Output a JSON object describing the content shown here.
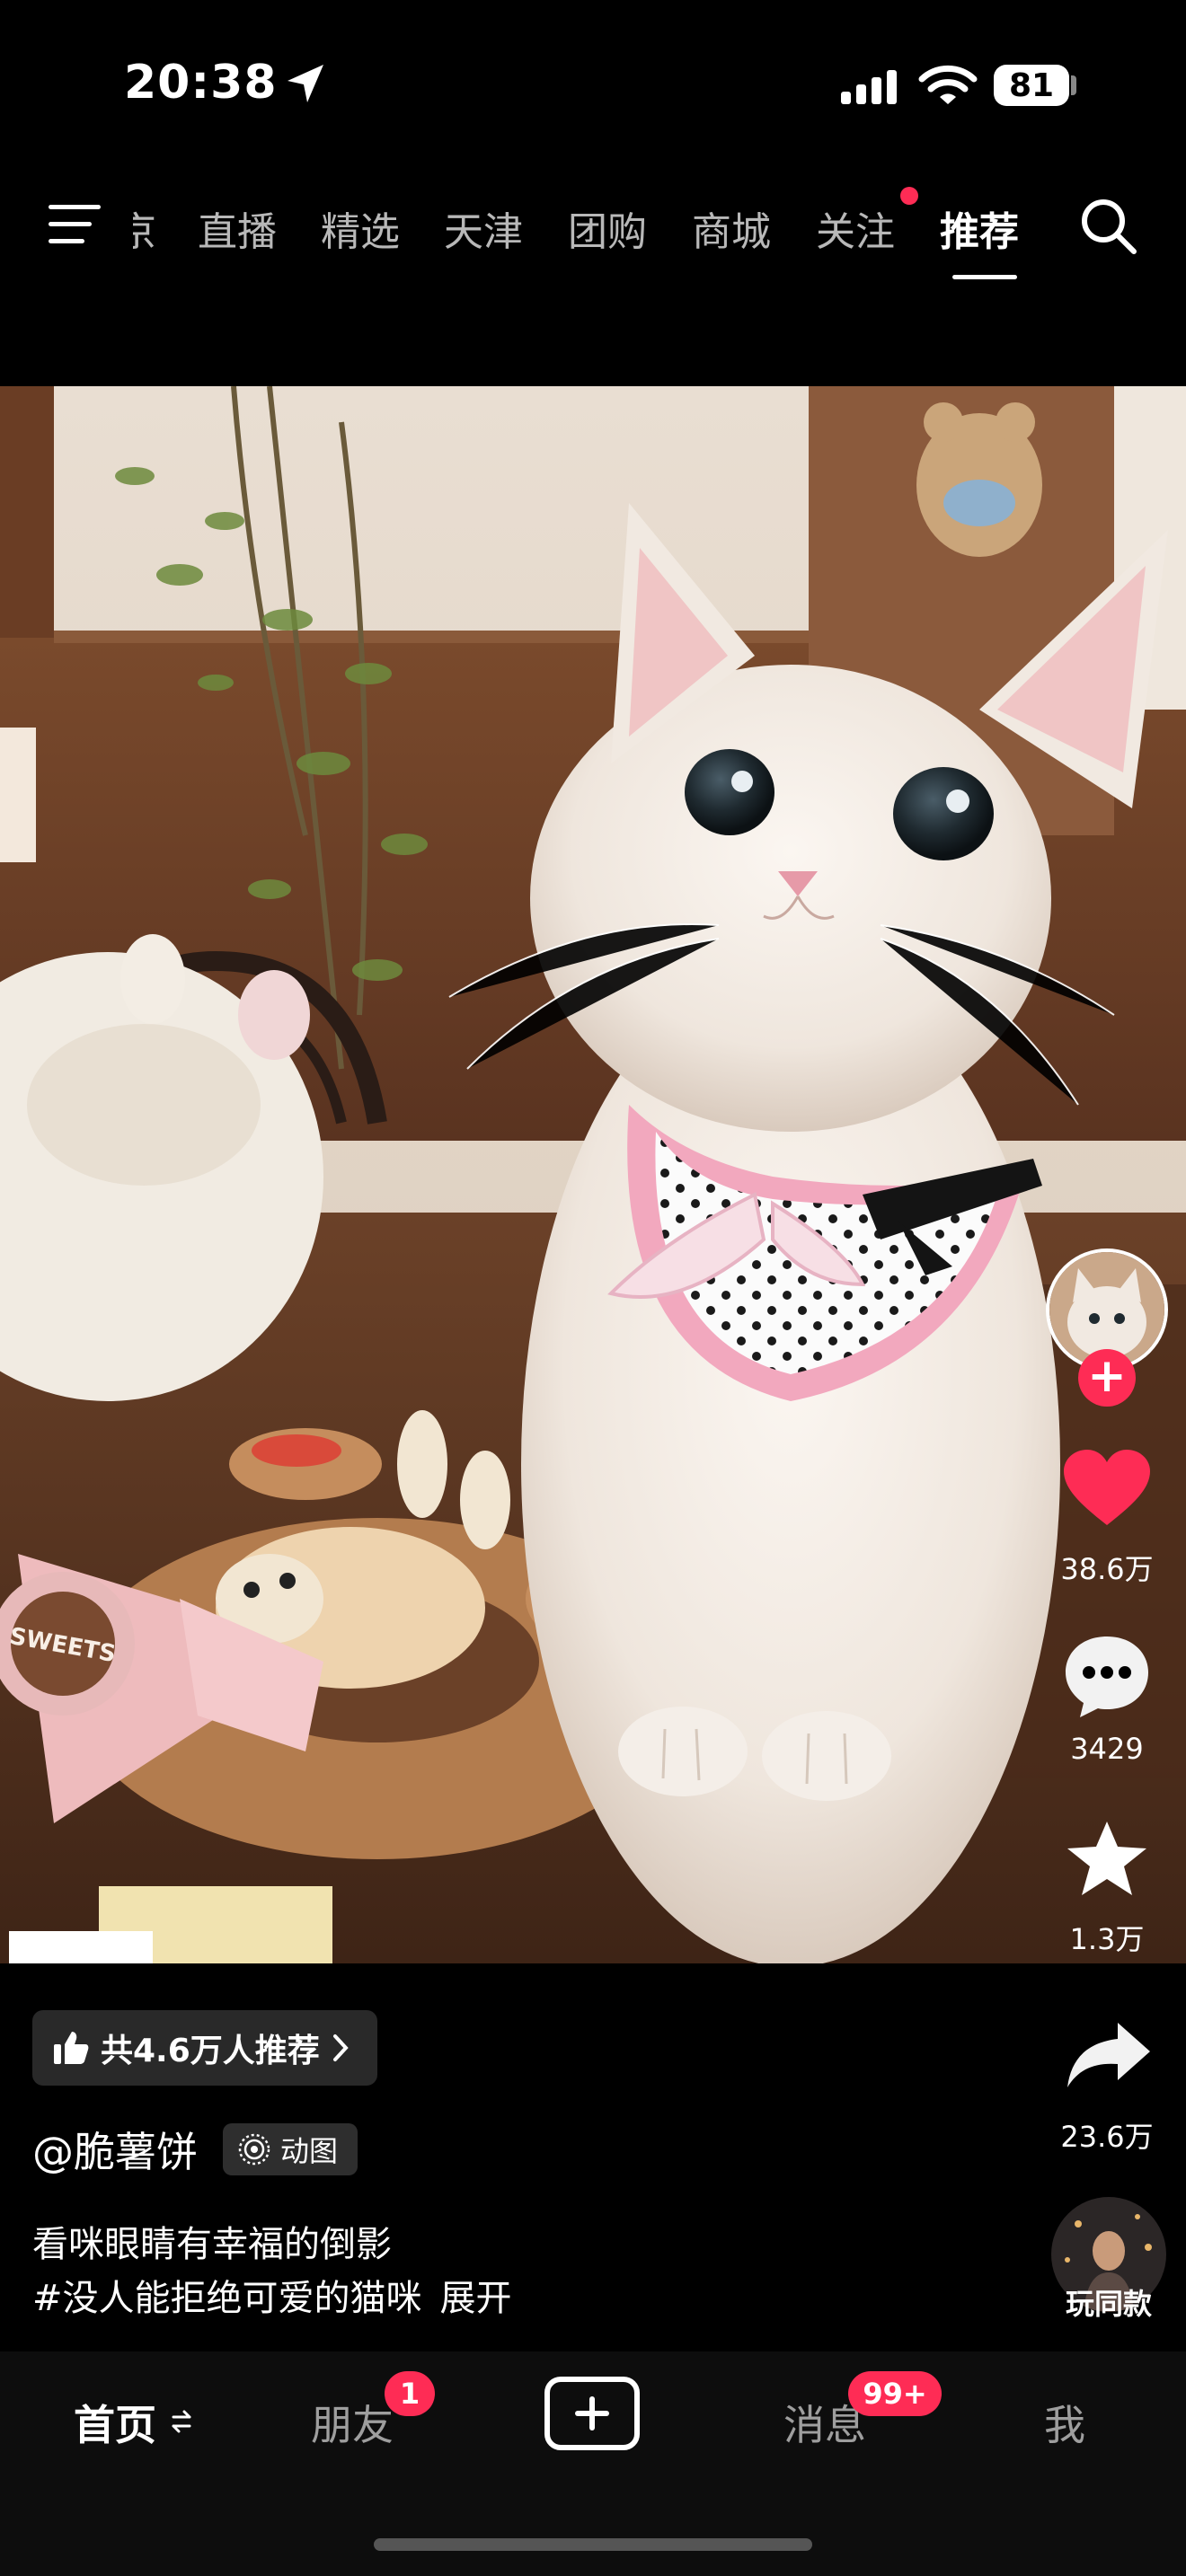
{
  "status_bar": {
    "time": "20:38",
    "battery": "81"
  },
  "top_nav": {
    "tabs": [
      {
        "label": "京"
      },
      {
        "label": "直播"
      },
      {
        "label": "精选"
      },
      {
        "label": "天津"
      },
      {
        "label": "团购"
      },
      {
        "label": "商城"
      },
      {
        "label": "关注"
      },
      {
        "label": "推荐"
      }
    ],
    "active_tab": "推荐"
  },
  "video": {
    "likes": "38.6万",
    "comments": "3429",
    "favorites": "1.3万",
    "shares": "23.6万",
    "recommend_pill": "共4.6万人推荐",
    "author": "@脆薯饼",
    "media_badge": "动图",
    "description_line1": "看咪眼睛有幸福的倒影",
    "description_line2": "#没人能拒绝可爱的猫咪",
    "expand_label": "展开",
    "same_style_label": "玩同款",
    "plush_brand_text": "SWEETS"
  },
  "bottom_nav": {
    "home": "首页",
    "friends": "朋友",
    "friends_badge": "1",
    "messages": "消息",
    "messages_badge": "99+",
    "me": "我"
  },
  "colors": {
    "accent": "#fe2c55",
    "background": "#000000"
  }
}
